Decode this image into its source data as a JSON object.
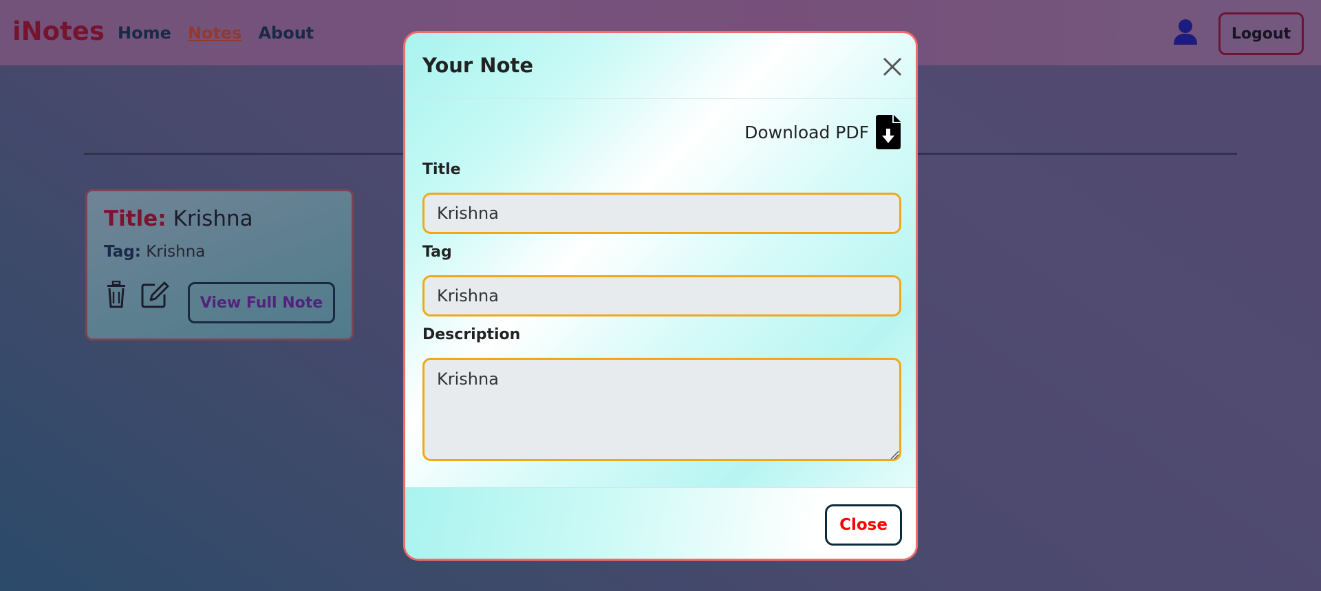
{
  "navbar": {
    "brand": "iNotes",
    "links": [
      {
        "label": "Home",
        "active": false
      },
      {
        "label": "Notes",
        "active": true
      },
      {
        "label": "About",
        "active": false
      }
    ],
    "user_icon": "user-icon",
    "logout_label": "Logout"
  },
  "note_card": {
    "title_label": "Title:",
    "title_value": "Krishna",
    "tag_label": "Tag:",
    "tag_value": "Krishna",
    "delete_icon": "trash-icon",
    "edit_icon": "edit-icon",
    "view_label": "View Full Note"
  },
  "modal": {
    "title": "Your Note",
    "close_icon": "close-icon",
    "download_label": "Download PDF",
    "download_icon": "file-download-icon",
    "fields": {
      "title": {
        "label": "Title",
        "value": "Krishna"
      },
      "tag": {
        "label": "Tag",
        "value": "Krishna"
      },
      "description": {
        "label": "Description",
        "value": "Krishna"
      }
    },
    "close_label": "Close"
  },
  "colors": {
    "brand": "#c5001a",
    "active_link": "#ff4a1a",
    "input_border": "#f0a81a",
    "close_text": "#ff0000",
    "view_text": "#7a1fb0"
  }
}
